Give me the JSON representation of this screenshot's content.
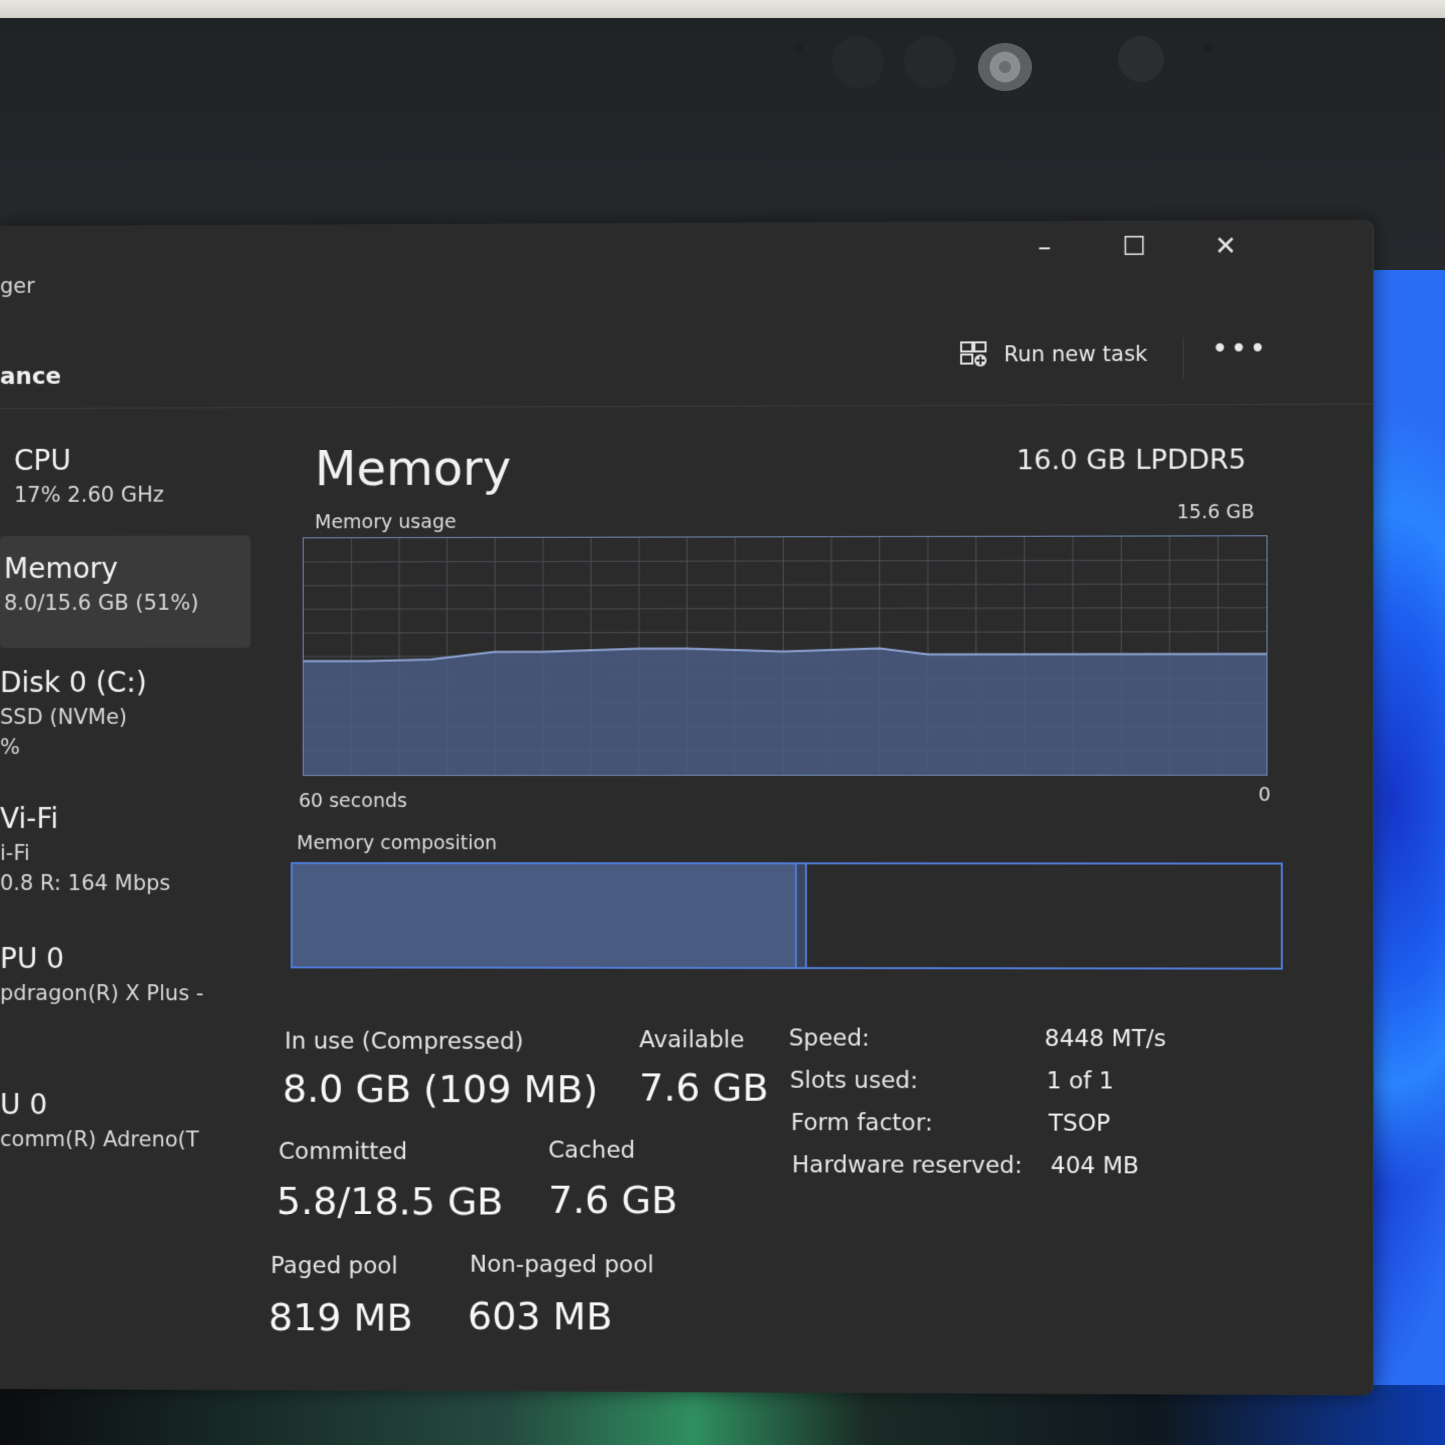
{
  "window": {
    "title_partial": "ger",
    "minimize_glyph": "–",
    "maximize_glyph": "☐",
    "close_glyph": "✕"
  },
  "toolbar": {
    "section_title_partial": "ance",
    "run_new_task_label": "Run new task",
    "more_glyph": "•••"
  },
  "sidebar": {
    "items": [
      {
        "name": "CPU",
        "sub1": "17%  2.60 GHz",
        "sub2": ""
      },
      {
        "name": "Memory",
        "sub1": "8.0/15.6 GB (51%)",
        "sub2": "",
        "selected": true
      },
      {
        "name": "Disk 0 (C:)",
        "sub1": "SSD (NVMe)",
        "sub2": "%"
      },
      {
        "name": "Vi-Fi",
        "sub1": "i-Fi",
        "sub2": "0.8  R: 164 Mbps"
      },
      {
        "name": "PU 0",
        "sub1": "pdragon(R) X Plus -",
        "sub2": ""
      },
      {
        "name": "U 0",
        "sub1": "comm(R) Adreno(T",
        "sub2": ""
      }
    ]
  },
  "main": {
    "title": "Memory",
    "memory_type": "16.0 GB LPDDR5",
    "usage_label": "Memory usage",
    "usage_max": "15.6 GB",
    "time_label": "60 seconds",
    "time_end": "0",
    "composition_label": "Memory composition",
    "composition": {
      "in_use_fraction": 0.51,
      "modified_fraction": 0.006,
      "standby_fraction": 0.484
    }
  },
  "chart_data": {
    "type": "area",
    "title": "Memory usage",
    "xlabel": "60 seconds",
    "ylim": [
      0,
      15.6
    ],
    "x": [
      60,
      56,
      52,
      48,
      45,
      42,
      39,
      36,
      33,
      30,
      27,
      24,
      21,
      18,
      15,
      12,
      9,
      6,
      3,
      0
    ],
    "values": [
      7.5,
      7.5,
      7.6,
      8.1,
      8.1,
      8.2,
      8.3,
      8.3,
      8.2,
      8.1,
      8.2,
      8.3,
      7.9,
      7.9,
      7.9,
      7.9,
      7.9,
      7.9,
      7.9,
      7.9
    ],
    "grid": true,
    "color": "#4a5b82"
  },
  "stats": {
    "in_use_label": "In use (Compressed)",
    "in_use_value": "8.0 GB (109 MB)",
    "available_label": "Available",
    "available_value": "7.6 GB",
    "committed_label": "Committed",
    "committed_value": "5.8/18.5 GB",
    "cached_label": "Cached",
    "cached_value": "7.6 GB",
    "paged_label": "Paged pool",
    "paged_value": "819 MB",
    "nonpaged_label": "Non-paged pool",
    "nonpaged_value": "603 MB"
  },
  "properties": {
    "speed_label": "Speed:",
    "speed_value": "8448 MT/s",
    "slots_label": "Slots used:",
    "slots_value": "1 of 1",
    "form_label": "Form factor:",
    "form_value": "TSOP",
    "hw_label": "Hardware reserved:",
    "hw_value": "404 MB"
  },
  "colors": {
    "accent": "#4f7bd8",
    "graph_fill": "#4a5b82",
    "window_bg": "#2b2b2b"
  }
}
